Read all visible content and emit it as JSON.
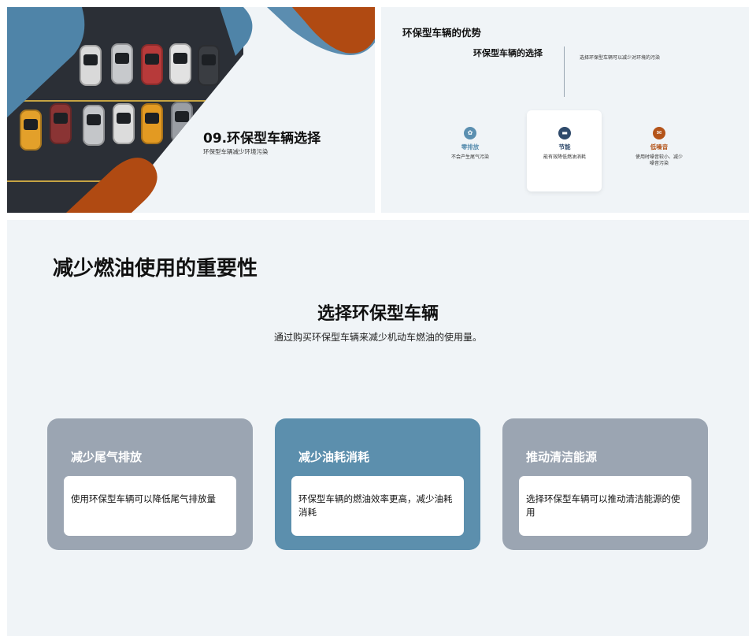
{
  "slide1": {
    "title": "09.环保型车辆选择",
    "subtitle": "环保型车辆减少环境污染"
  },
  "slide2": {
    "title": "环保型车辆的优势",
    "heading": "环保型车辆的选择",
    "note": "选择环保型车辆可以减少对环境的污染",
    "features": [
      {
        "label": "零排放",
        "desc": "不会产生尾气污染",
        "icon": "gear-icon",
        "color": "#5b8fb0"
      },
      {
        "label": "节能",
        "desc": "能有效降低燃油消耗",
        "icon": "card-icon",
        "color": "#2f4a6b"
      },
      {
        "label": "低噪音",
        "desc": "使用时噪音较小、减少噪音污染",
        "icon": "mail-icon",
        "color": "#b4541a"
      }
    ]
  },
  "slide3": {
    "title": "减少燃油使用的重要性",
    "heading": "选择环保型车辆",
    "intro": "通过购买环保型车辆来减少机动车燃油的使用量。",
    "cards": [
      {
        "title": "减少尾气排放",
        "body": "使用环保型车辆可以降低尾气排放量",
        "color": "#9ba5b2"
      },
      {
        "title": "减少油耗消耗",
        "body": "环保型车辆的燃油效率更高，减少油耗消耗",
        "color": "#5c8fad"
      },
      {
        "title": "推动清洁能源",
        "body": "选择环保型车辆可以推动清洁能源的使用",
        "color": "#9ba5b2"
      }
    ]
  },
  "colors": {
    "accent_blue": "#5b8db0",
    "accent_orange": "#b04a12",
    "panel_bg": "#f0f4f7"
  }
}
